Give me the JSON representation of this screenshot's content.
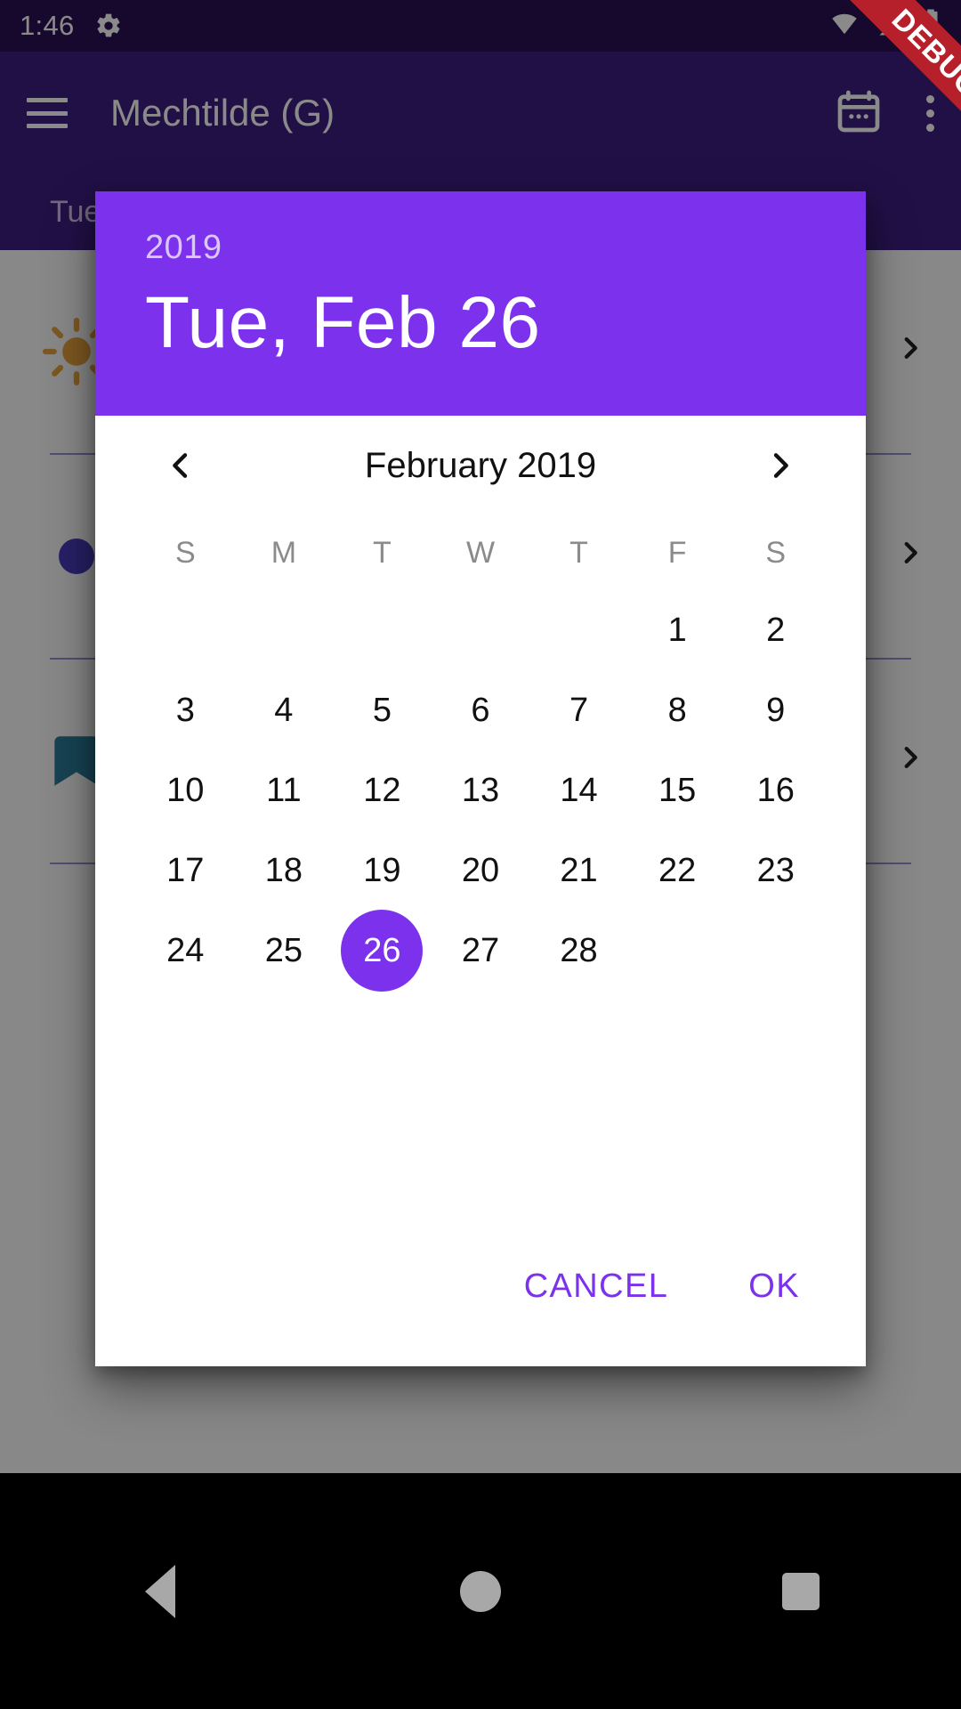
{
  "status_bar": {
    "time": "1:46",
    "gear_icon": "settings-gear-icon",
    "wifi_icon": "wifi-icon",
    "signal_icon": "cell-signal-icon",
    "battery_icon": "battery-charging-icon"
  },
  "debug_ribbon": {
    "label": "DEBUG",
    "color": "#b5202a"
  },
  "app_bar": {
    "menu_icon": "hamburger-menu-icon",
    "title": "Mechtilde (G)",
    "calendar_icon": "calendar-icon",
    "overflow_icon": "overflow-menu-icon"
  },
  "sub_header": {
    "text": "Tue"
  },
  "background_list": {
    "rows": [
      {
        "icon": "sun-icon",
        "chevron": "chevron-right-icon"
      },
      {
        "icon": "dot-icon",
        "chevron": "chevron-right-icon"
      },
      {
        "icon": "bookmark-icon",
        "chevron": "chevron-right-icon"
      }
    ]
  },
  "dialog": {
    "year": "2019",
    "selected_date_label": "Tue, Feb 26",
    "header_color": "#7c32ec",
    "accent_color": "#7c32ec",
    "month_nav": {
      "prev_icon": "chevron-left-icon",
      "next_icon": "chevron-right-icon",
      "month_label": "February 2019"
    },
    "weekday_headers": [
      "S",
      "M",
      "T",
      "W",
      "T",
      "F",
      "S"
    ],
    "weeks": [
      [
        "",
        "",
        "",
        "",
        "",
        "1",
        "2"
      ],
      [
        "3",
        "4",
        "5",
        "6",
        "7",
        "8",
        "9"
      ],
      [
        "10",
        "11",
        "12",
        "13",
        "14",
        "15",
        "16"
      ],
      [
        "17",
        "18",
        "19",
        "20",
        "21",
        "22",
        "23"
      ],
      [
        "24",
        "25",
        "26",
        "27",
        "28",
        "",
        ""
      ]
    ],
    "selected_day": "26",
    "cancel_label": "CANCEL",
    "ok_label": "OK"
  },
  "nav_bar": {
    "back_icon": "nav-back-icon",
    "home_icon": "nav-home-icon",
    "recents_icon": "nav-recents-icon"
  }
}
